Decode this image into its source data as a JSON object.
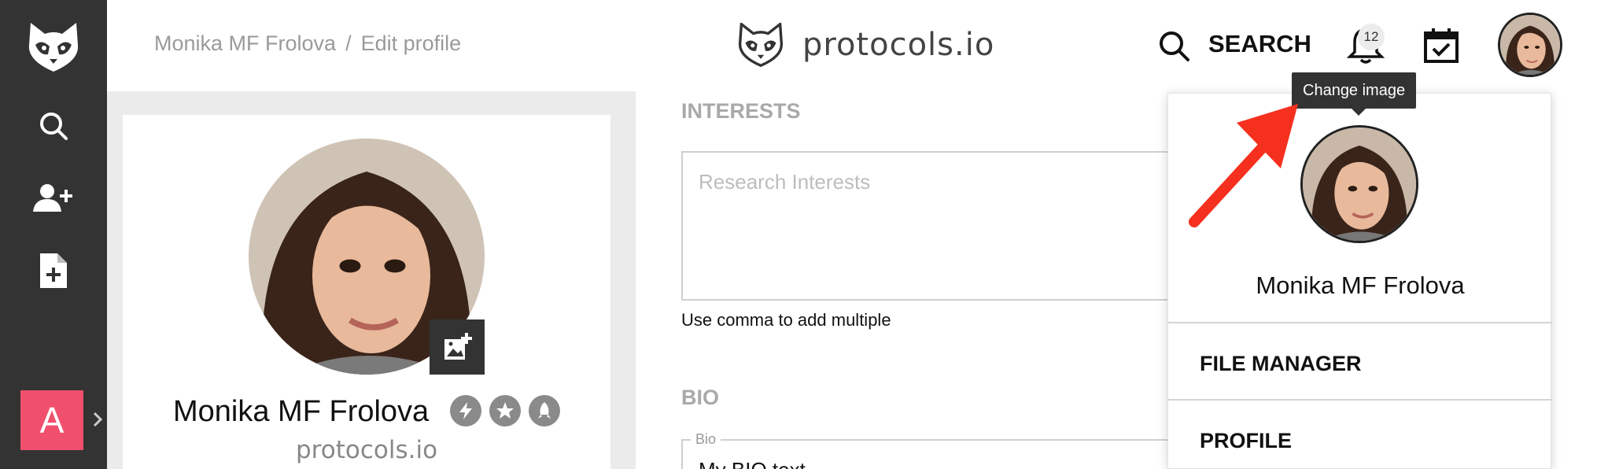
{
  "sidebar": {
    "items": [
      {
        "name": "logo-icon"
      },
      {
        "name": "search-icon"
      },
      {
        "name": "add-person-icon"
      },
      {
        "name": "new-file-icon"
      }
    ],
    "workspace_letter": "A"
  },
  "header": {
    "breadcrumb": {
      "user": "Monika MF Frolova",
      "separator": "/",
      "page": "Edit profile"
    },
    "brand": "protocols.io",
    "search_label": "SEARCH",
    "notification_count": "12"
  },
  "profile_card": {
    "name": "Monika MF Frolova",
    "organization": "protocols.io",
    "badges": [
      "lightning-badge-icon",
      "star-badge-icon",
      "rocket-badge-icon"
    ]
  },
  "form": {
    "interests_title": "INTERESTS",
    "interests_placeholder": "Research Interests",
    "interests_helper": "Use comma to add multiple",
    "bio_title": "BIO",
    "bio_legend": "Bio",
    "bio_value": "My BIO text"
  },
  "dropdown": {
    "name": "Monika MF Frolova",
    "items": [
      "FILE MANAGER",
      "PROFILE"
    ]
  },
  "tooltip": "Change image",
  "colors": {
    "sidebar": "#333333",
    "workspace_avatar": "#f0506e",
    "annotation_arrow": "#f5301e"
  }
}
